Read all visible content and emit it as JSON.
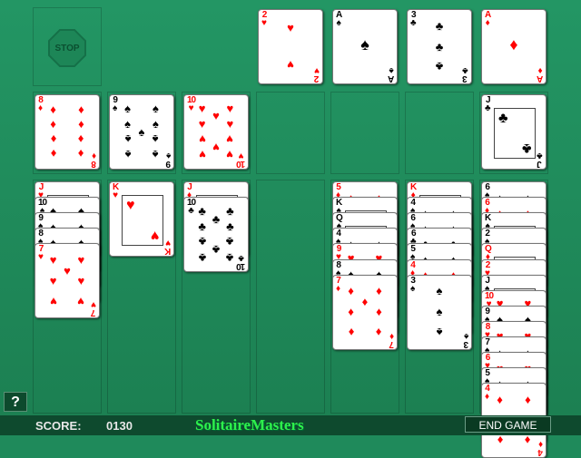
{
  "game": {
    "stop_label": "STOP",
    "help_label": "?",
    "score_label": "SCORE:",
    "score_value": "0130",
    "brand": "SolitaireMasters",
    "end_game_label": "END GAME"
  },
  "colors": {
    "felt": "#1f8a5b",
    "status_bar": "#0e4a2e",
    "brand_green": "#2ef04c",
    "red_suit": "#ff0000"
  },
  "foundations": [
    {
      "rank": "2",
      "suit": "♥"
    },
    {
      "rank": "A",
      "suit": "♠"
    },
    {
      "rank": "3",
      "suit": "♣"
    },
    {
      "rank": "A",
      "suit": "♦"
    }
  ],
  "reserve": [
    {
      "rank": "8",
      "suit": "♦"
    },
    {
      "rank": "9",
      "suit": "♠"
    },
    {
      "rank": "10",
      "suit": "♥"
    },
    null,
    null,
    null,
    {
      "rank": "J",
      "suit": "♣"
    }
  ],
  "tableau": [
    [
      {
        "rank": "J",
        "suit": "♥"
      },
      {
        "rank": "10",
        "suit": "♠"
      },
      {
        "rank": "9",
        "suit": "♠"
      },
      {
        "rank": "8",
        "suit": "♠"
      },
      {
        "rank": "7",
        "suit": "♥"
      }
    ],
    [
      {
        "rank": "K",
        "suit": "♥"
      }
    ],
    [
      {
        "rank": "J",
        "suit": "♦"
      },
      {
        "rank": "10",
        "suit": "♣"
      }
    ],
    [],
    [
      {
        "rank": "5",
        "suit": "♦"
      },
      {
        "rank": "K",
        "suit": "♠"
      },
      {
        "rank": "Q",
        "suit": "♠"
      },
      {
        "rank": "4",
        "suit": "♠"
      },
      {
        "rank": "9",
        "suit": "♥"
      },
      {
        "rank": "8",
        "suit": "♠"
      },
      {
        "rank": "7",
        "suit": "♦"
      }
    ],
    [
      {
        "rank": "K",
        "suit": "♦"
      },
      {
        "rank": "4",
        "suit": "♠"
      },
      {
        "rank": "6",
        "suit": "♠"
      },
      {
        "rank": "6",
        "suit": "♣"
      },
      {
        "rank": "5",
        "suit": "♠"
      },
      {
        "rank": "4",
        "suit": "♦"
      },
      {
        "rank": "3",
        "suit": "♠"
      }
    ],
    [
      {
        "rank": "6",
        "suit": "♠"
      },
      {
        "rank": "6",
        "suit": "♦"
      },
      {
        "rank": "K",
        "suit": "♠"
      },
      {
        "rank": "2",
        "suit": "♠"
      },
      {
        "rank": "Q",
        "suit": "♦"
      },
      {
        "rank": "2",
        "suit": "♥"
      },
      {
        "rank": "J",
        "suit": "♠"
      },
      {
        "rank": "10",
        "suit": "♥"
      },
      {
        "rank": "9",
        "suit": "♠"
      },
      {
        "rank": "8",
        "suit": "♥"
      },
      {
        "rank": "7",
        "suit": "♠"
      },
      {
        "rank": "6",
        "suit": "♥"
      },
      {
        "rank": "5",
        "suit": "♠"
      },
      {
        "rank": "4",
        "suit": "♦"
      }
    ]
  ]
}
